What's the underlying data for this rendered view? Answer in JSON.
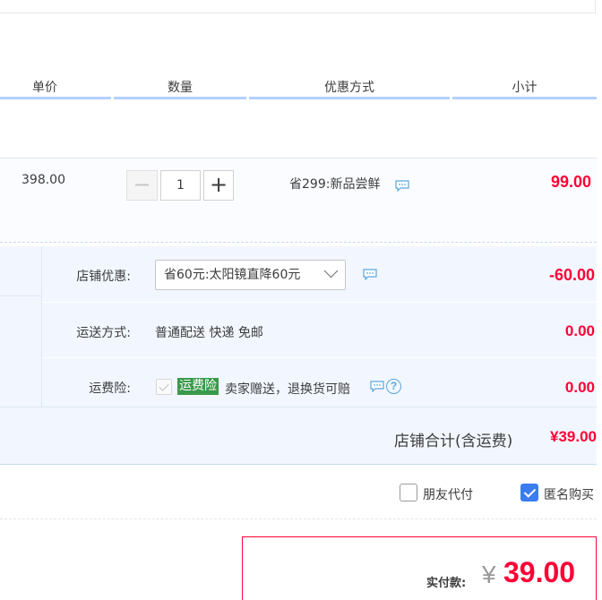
{
  "columns": {
    "unit_price": "单价",
    "quantity": "数量",
    "discount": "优惠方式",
    "subtotal": "小计"
  },
  "item": {
    "unit_price": "398.00",
    "quantity": "1",
    "minus_label": "−",
    "plus_label": "+",
    "promotion": "省299:新品尝鲜",
    "subtotal": "99.00"
  },
  "shop": {
    "discount_label": "店铺优惠:",
    "discount_selected": "省60元:太阳镜直降60元",
    "discount_amount": "-60.00",
    "shipping_label": "运送方式:",
    "shipping_text": "普通配送 快递 免邮",
    "shipping_amount": "0.00",
    "insurance_label": "运费险:",
    "insurance_badge": "运费险",
    "insurance_text": "卖家赠送，退换货可赔",
    "insurance_amount": "0.00",
    "help_glyph": "?",
    "total_label": "店铺合计(含运费)",
    "total_value": "¥39.00"
  },
  "options": {
    "friend_pay_label": "朋友代付",
    "friend_pay_checked": false,
    "anonymous_label": "匿名购买",
    "anonymous_checked": true
  },
  "payment": {
    "label": "实付款:",
    "currency": "¥",
    "amount": "39.00"
  },
  "icons": {
    "chat": "chat-bubble-icon",
    "help": "question-circle-icon",
    "chevron": "chevron-down-icon"
  },
  "colors": {
    "accent_red": "#ff0036",
    "header_line": "#b2d1ff",
    "shop_bg": "#f2f7ff",
    "insurance_green": "#3a9a4b",
    "checkbox_blue": "#3b7cf0"
  }
}
